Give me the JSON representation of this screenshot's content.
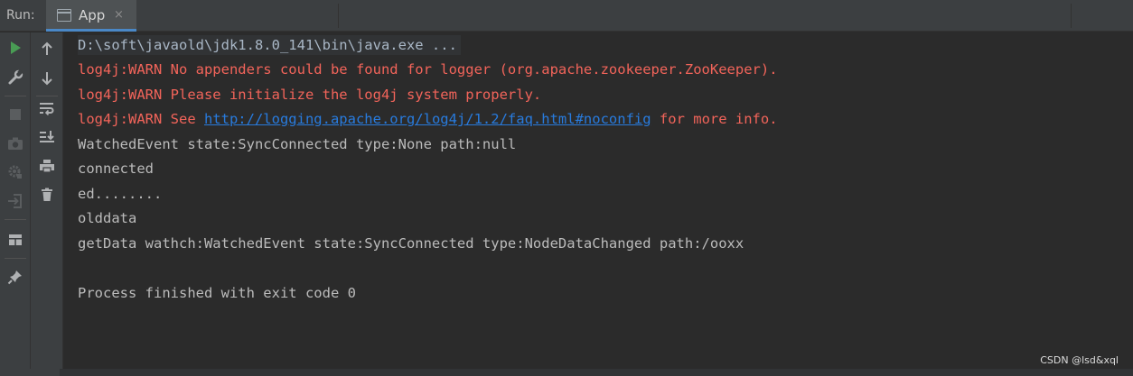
{
  "run_panel": {
    "label": "Run:",
    "tab": {
      "label": "App",
      "close_glyph": "×",
      "icon": "application-window-icon"
    }
  },
  "toolbar_left": [
    {
      "name": "rerun",
      "icon": "play-icon"
    },
    {
      "name": "settings",
      "icon": "wrench-icon"
    },
    {
      "name": "stop",
      "icon": "stop-icon"
    },
    {
      "name": "thread-dump",
      "icon": "camera-icon"
    },
    {
      "name": "settings-gear",
      "icon": "gear-icon"
    },
    {
      "name": "restore-layout",
      "icon": "login-icon"
    },
    {
      "name": "layout",
      "icon": "layout-icon"
    },
    {
      "name": "pin",
      "icon": "pin-icon"
    }
  ],
  "toolbar_right": [
    {
      "name": "scroll-up",
      "icon": "arrow-up-icon"
    },
    {
      "name": "scroll-down",
      "icon": "arrow-down-icon"
    },
    {
      "name": "soft-wrap",
      "icon": "soft-wrap-icon"
    },
    {
      "name": "scroll-to-end",
      "icon": "scroll-to-end-icon"
    },
    {
      "name": "print",
      "icon": "print-icon"
    },
    {
      "name": "clear-all",
      "icon": "trash-icon"
    }
  ],
  "console": {
    "command": "D:\\soft\\javaold\\jdk1.8.0_141\\bin\\java.exe ...",
    "warn1": "log4j:WARN No appenders could be found for logger (org.apache.zookeeper.ZooKeeper).",
    "warn2": "log4j:WARN Please initialize the log4j system properly.",
    "warn3_prefix": "log4j:WARN See ",
    "warn3_link": "http://logging.apache.org/log4j/1.2/faq.html#noconfig",
    "warn3_suffix": " for more info.",
    "line_event": "WatchedEvent state:SyncConnected type:None path:null",
    "line_connected": "connected",
    "line_ed": "ed........",
    "line_olddata": "olddata",
    "line_getdata": "getData wathch:WatchedEvent state:SyncConnected type:NodeDataChanged path:/ooxx",
    "line_exit": "Process finished with exit code 0"
  },
  "watermark": "CSDN @lsd&xql",
  "colors": {
    "warn": "#f2645a",
    "link": "#287bde",
    "text": "#bbbbbb",
    "run_green": "#499c54",
    "accent": "#4a88c7"
  }
}
